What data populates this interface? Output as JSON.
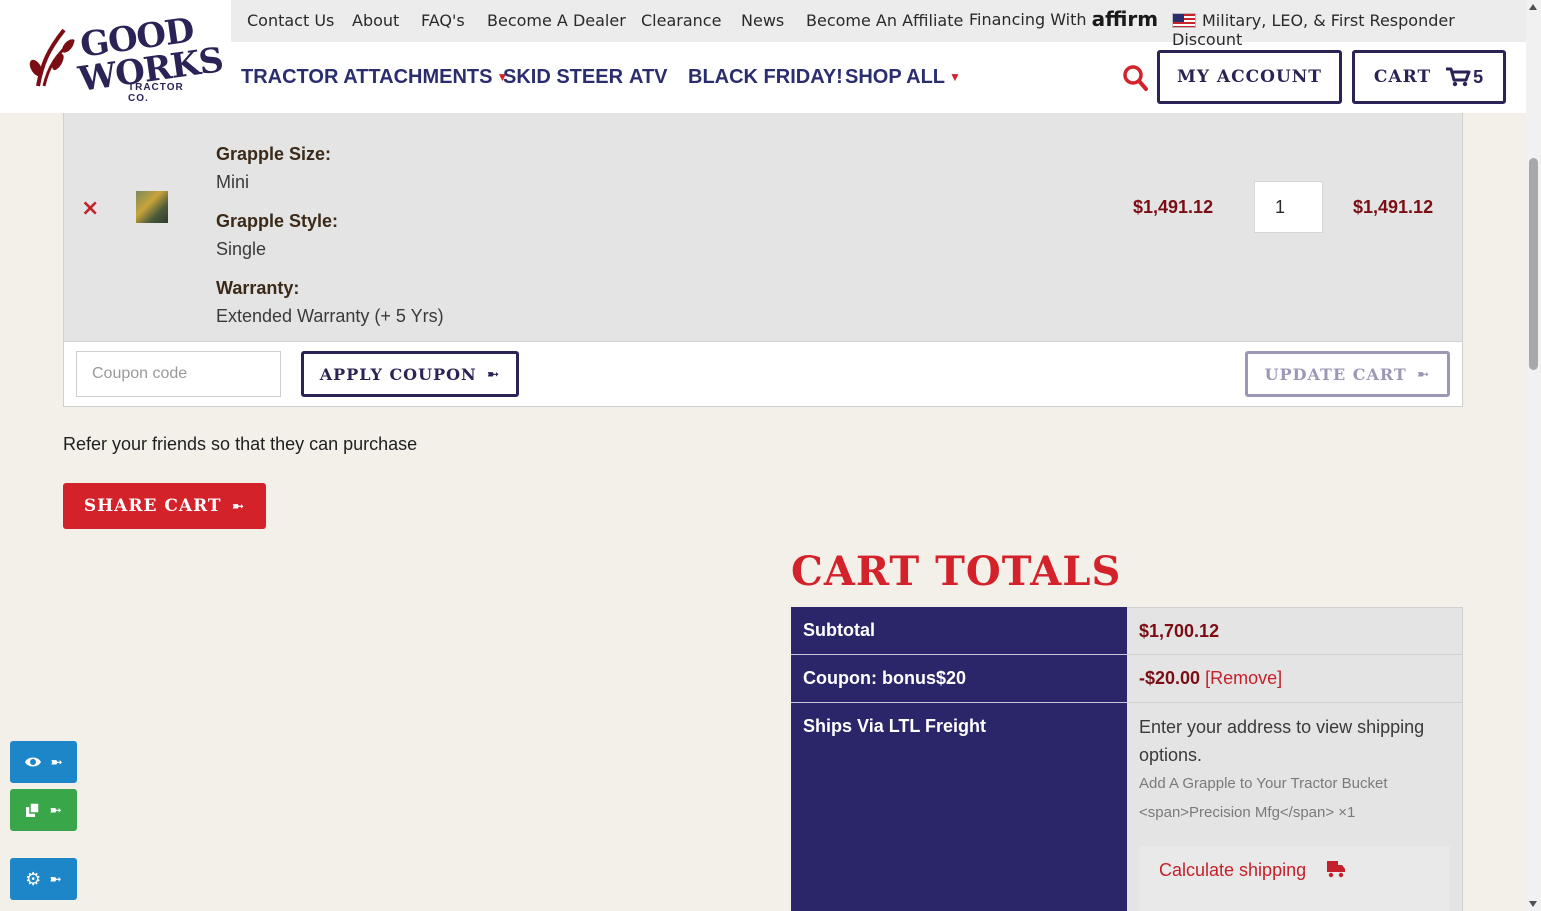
{
  "header": {
    "logo": {
      "line1": "GOOD",
      "line2": "WORKS",
      "line3": "TRACTOR CO."
    },
    "topbar": {
      "contact": "Contact Us",
      "about": "About",
      "faq": "FAQ's",
      "dealer": "Become A Dealer",
      "clearance": "Clearance",
      "news": "News",
      "affiliate": "Become An Affiliate",
      "financing": "Financing With",
      "affirm": "affirm",
      "military": "Military, LEO, & First Responder Discount"
    },
    "nav": {
      "tractor": "TRACTOR ATTACHMENTS",
      "skid": "SKID STEER",
      "atv": "ATV",
      "friday": "BLACK FRIDAY!",
      "shop": "SHOP ALL"
    },
    "account_label": "MY ACCOUNT",
    "cart_label": "CART",
    "cart_count": "5"
  },
  "cart_item": {
    "remove": "×",
    "fields": [
      {
        "key": "Grapple Size:",
        "value": "Mini"
      },
      {
        "key": "Grapple Style:",
        "value": "Single"
      },
      {
        "key": "Warranty:",
        "value": "Extended Warranty (+ 5 Yrs)"
      }
    ],
    "price": "$1,491.12",
    "quantity": "1",
    "subtotal": "$1,491.12"
  },
  "coupon": {
    "placeholder": "Coupon code",
    "apply_label": "APPLY COUPON",
    "update_label": "UPDATE CART"
  },
  "refer": {
    "text": "Refer your friends so that they can purchase",
    "share_label": "SHARE CART"
  },
  "totals": {
    "title": "CART TOTALS",
    "subtotal_label": "Subtotal",
    "subtotal_value": "$1,700.12",
    "coupon_label": "Coupon: bonus$20",
    "coupon_value": "-$20.00",
    "coupon_remove": "[Remove]",
    "shipping_label": "Ships Via LTL Freight",
    "shipping_line1": "Enter your address to view shipping",
    "shipping_line2": "options.",
    "shipping_item1": "Add A Grapple to Your Tractor Bucket",
    "shipping_item2": "<span>Precision Mfg</span> ×1",
    "calc_label": "Calculate shipping"
  },
  "colors": {
    "navy": "#2b2569",
    "red": "#d32229",
    "maroon": "#7a0e14",
    "cream": "#f3efe9"
  },
  "icons": [
    "search-icon",
    "cart-icon",
    "arrow-right-icon",
    "truck-icon",
    "eye-icon",
    "copy-icon",
    "gear-icon",
    "flag-icon"
  ]
}
